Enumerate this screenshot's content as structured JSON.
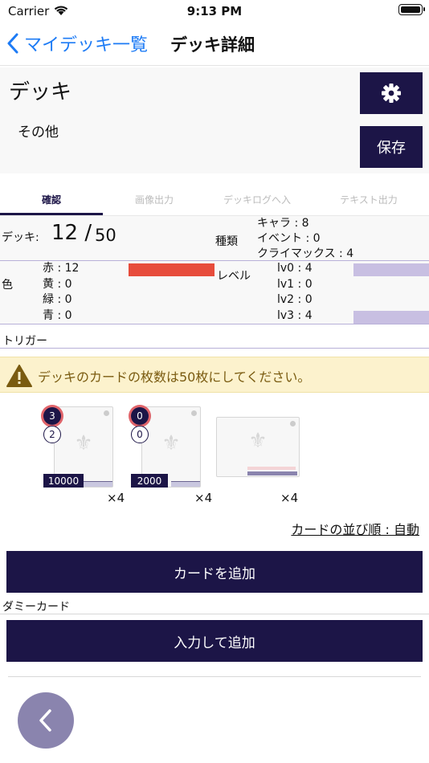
{
  "status_bar": {
    "carrier": "Carrier",
    "time": "9:13 PM"
  },
  "nav": {
    "back_label": "マイデッキ一覧",
    "title": "デッキ詳細"
  },
  "deck": {
    "name": "デッキ",
    "category": "その他",
    "save_label": "保存"
  },
  "tabs": [
    "確認",
    "画像出力",
    "デッキログへ入",
    "テキスト出力"
  ],
  "summary": {
    "deck_label": "デッキ:",
    "deck_count": "12 /",
    "deck_max": "50",
    "type_label": "種類",
    "types": [
      "キャラ : 8",
      "イベント : 0",
      "クライマックス : 4"
    ]
  },
  "colors": {
    "label": "色",
    "items": [
      "赤 : 12",
      "黄 : 0",
      "緑 : 0",
      "青 : 0"
    ],
    "level_label": "レベル",
    "levels": [
      "lv0 : 4",
      "lv1 : 0",
      "lv2 : 0",
      "lv3 : 4"
    ]
  },
  "trigger_label": "トリガー",
  "warning": "デッキのカードの枚数は50枚にしてください。",
  "cards": [
    {
      "badge_top": "3",
      "badge_bottom": "2",
      "power": "10000",
      "count": "×4"
    },
    {
      "badge_top": "0",
      "badge_bottom": "0",
      "power": "2000",
      "count": "×4"
    },
    {
      "count": "×4"
    }
  ],
  "sort_label": "カードの並び順 : 自動",
  "add_card_label": "カードを追加",
  "dummy_label": "ダミーカード",
  "add_input_label": "入力して追加",
  "accent_color": "#1c1547",
  "link_color": "#1d7bf5"
}
